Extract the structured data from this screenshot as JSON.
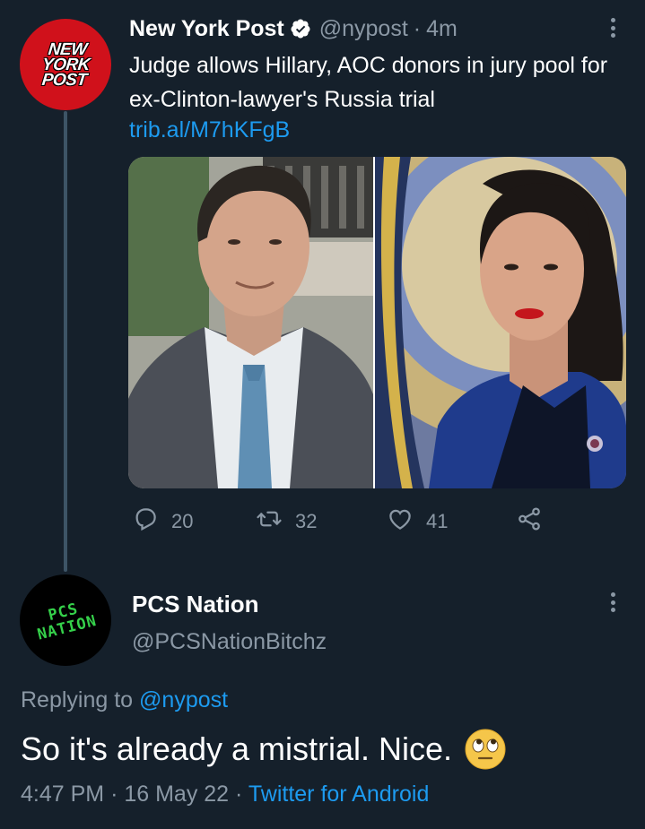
{
  "tweet1": {
    "author_name": "New York Post",
    "handle": "@nypost",
    "separator": "·",
    "time": "4m",
    "avatar_text": "NEW YORK POST",
    "text": "Judge allows Hillary, AOC donors in jury pool for ex-Clinton-lawyer's Russia trial",
    "link": "trib.al/M7hKFgB",
    "media": [
      "man-in-suit-photo",
      "woman-congress-photo"
    ],
    "actions": {
      "reply_count": "20",
      "retweet_count": "32",
      "like_count": "41"
    }
  },
  "tweet2": {
    "author_name": "PCS Nation",
    "handle": "@PCSNationBitchz",
    "avatar_text": "PCS NATION",
    "replying_prefix": "Replying to",
    "replying_to": "@nypost",
    "text": "So it's already a mistrial. Nice.",
    "emoji": "face-with-rolling-eyes",
    "time": "4:47 PM",
    "separator": "·",
    "date": "16 May 22",
    "source": "Twitter for Android"
  },
  "colors": {
    "background": "#15202b",
    "link": "#1d9bf0",
    "muted": "#8b98a5",
    "nyp_red": "#d0111b",
    "pcs_green": "#35d04a"
  }
}
